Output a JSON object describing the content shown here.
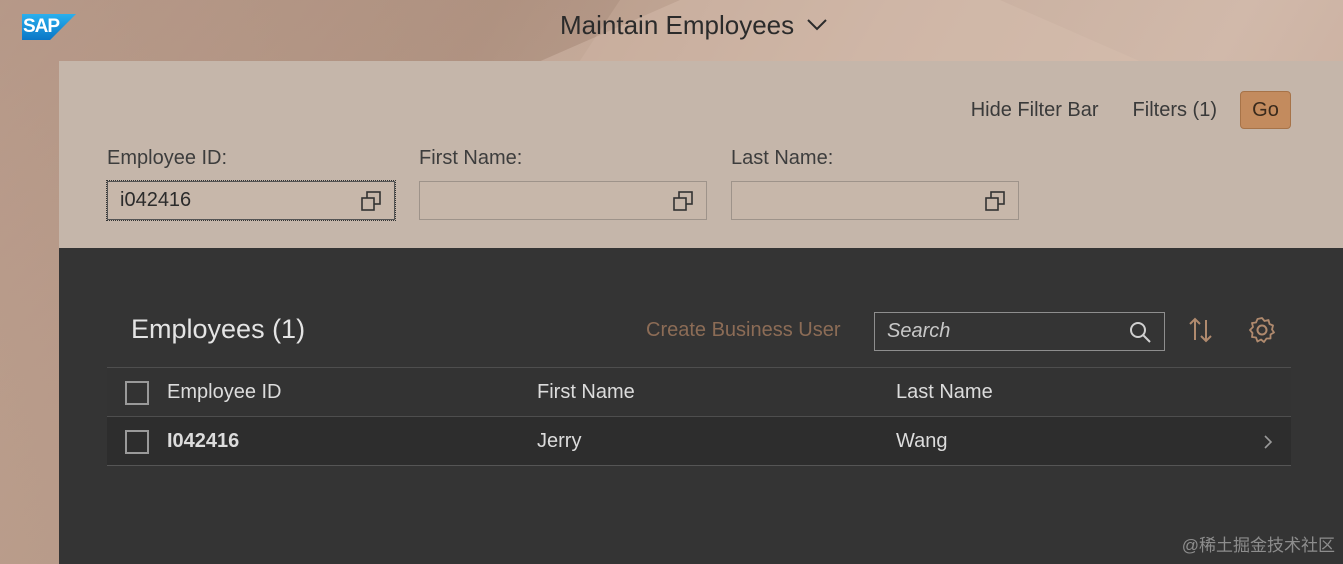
{
  "app": {
    "logo_text": "SAP",
    "title": "Maintain Employees"
  },
  "filter_bar": {
    "hide_label": "Hide Filter Bar",
    "filters_label": "Filters (1)",
    "go_label": "Go",
    "fields": [
      {
        "label": "Employee ID:",
        "value": "i042416"
      },
      {
        "label": "First Name:",
        "value": ""
      },
      {
        "label": "Last Name:",
        "value": ""
      }
    ]
  },
  "table": {
    "title": "Employees (1)",
    "create_label": "Create Business User",
    "search_placeholder": "Search",
    "columns": [
      "Employee ID",
      "First Name",
      "Last Name"
    ],
    "rows": [
      {
        "employee_id": "I042416",
        "first_name": "Jerry",
        "last_name": "Wang"
      }
    ]
  },
  "watermark": "@稀土掘金技术社区",
  "colors": {
    "accent": "#c38b5e",
    "filter_bg": "#c5b6aa",
    "table_bg": "#343434"
  }
}
